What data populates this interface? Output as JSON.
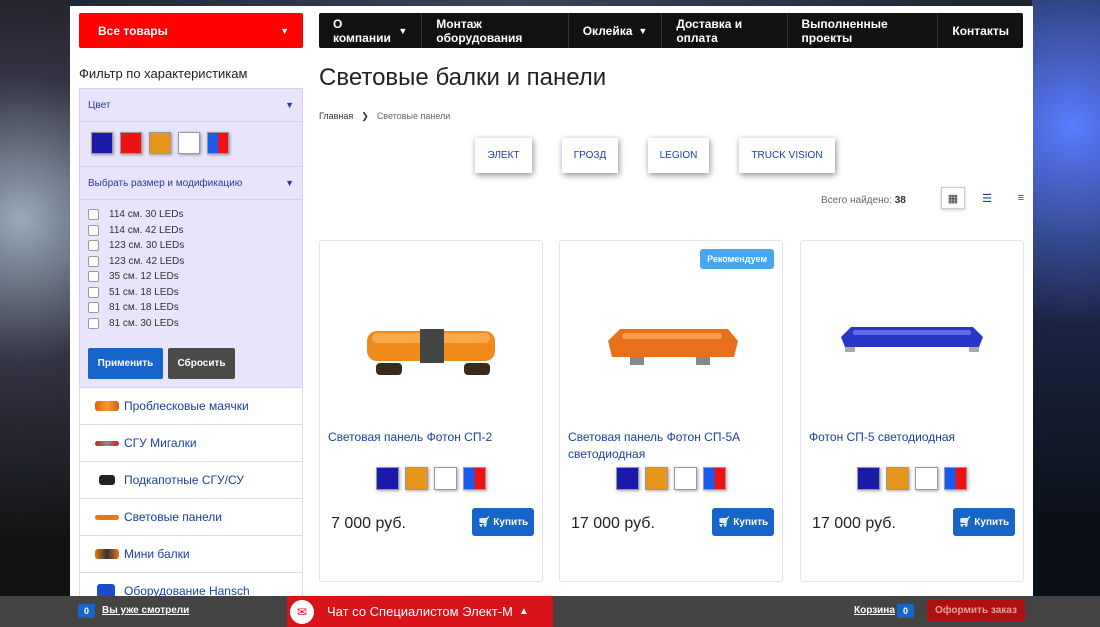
{
  "left": {
    "all_goods": "Все товары",
    "filter_title": "Фильтр по характеристикам",
    "color_label": "Цвет",
    "size_label": "Выбрать размер и модификацию",
    "colors": [
      "#1a1aa8",
      "#ee1111",
      "#e6961a",
      "#ffffff",
      "blue-red"
    ],
    "sizes": [
      "114 см. 30 LEDs",
      "114 см. 42 LEDs",
      "123 см. 30 LEDs",
      "123 см. 42 LEDs",
      "35 см. 12 LEDs",
      "51 см. 18 LEDs",
      "81 см. 18 LEDs",
      "81 см. 30 LEDs"
    ],
    "apply": "Применить",
    "reset": "Сбросить",
    "categories": [
      "Проблесковые маячки",
      "СГУ Мигалки",
      "Подкапотные СГУ/СУ",
      "Световые панели",
      "Мини балки",
      "Оборудование Hansch"
    ]
  },
  "nav": {
    "about": "О компании",
    "install": "Монтаж оборудования",
    "wrap": "Оклейка",
    "delivery": "Доставка и оплата",
    "projects": "Выполненные проекты",
    "contacts": "Контакты"
  },
  "main": {
    "title": "Световые балки и панели",
    "crumb_home": "Главная",
    "crumb_current": "Световые панели",
    "brands": [
      "ЭЛЕКТ",
      "ГРОЗД",
      "LEGION",
      "TRUCK VISION"
    ],
    "found_label": "Всего найдено:",
    "found_count": "38"
  },
  "products": [
    {
      "name": "Световая панель Фотон СП-2",
      "price": "7 000 руб.",
      "buy": "Купить",
      "badge": ""
    },
    {
      "name": "Световая панель Фотон СП-5А светодиодная",
      "price": "17 000 руб.",
      "buy": "Купить",
      "badge": "Рекомендуем"
    },
    {
      "name": "Фотон СП-5 светодиодная",
      "price": "17 000 руб.",
      "buy": "Купить",
      "badge": ""
    }
  ],
  "bottom": {
    "viewed_count": "0",
    "viewed": "Вы уже смотрели",
    "chat": "Чат со Специалистом Элект-М",
    "cart": "Корзина",
    "cart_count": "0",
    "order": "Оформить заказ"
  }
}
